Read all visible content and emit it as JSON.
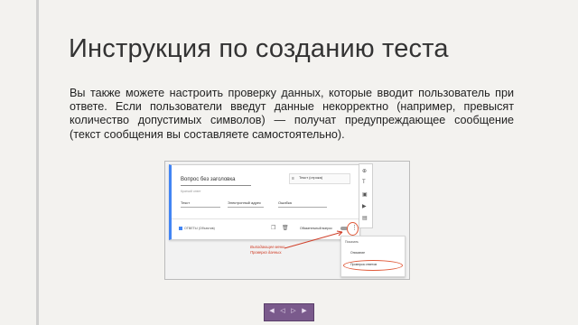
{
  "slide": {
    "title": "Инструкция по созданию теста",
    "body": "Вы также можете настроить проверку данных, которые вводит пользователь при ответе. Если пользователи введут данные некорректно (например, превысят количество допустимых символов) — получат предупреждающее сообщение (текст сообщения вы составляете самостоятельно)."
  },
  "screenshot": {
    "question_title": "Вопрос без заголовка",
    "question_type": "Текст (строка)",
    "answer_hint": "Краткий ответ",
    "validation": {
      "type": "Текст",
      "condition": "Электронный адрес",
      "error": "Ошибка"
    },
    "footer_note": "ОТВЕТЫ (Объектив)",
    "required_label": "Обязательный вопрос",
    "menu": {
      "header": "Показать",
      "items": [
        "Описание",
        "Проверка ответов"
      ]
    },
    "annotation": "Выпадающее меню. Проверка данных."
  },
  "icons": {
    "copy": "copy-icon",
    "trash": "trash-icon",
    "more": "more-vert-icon"
  },
  "colors": {
    "accent": "#4285f4",
    "annotation": "#d0402a",
    "nav": "#7a5a8c"
  }
}
